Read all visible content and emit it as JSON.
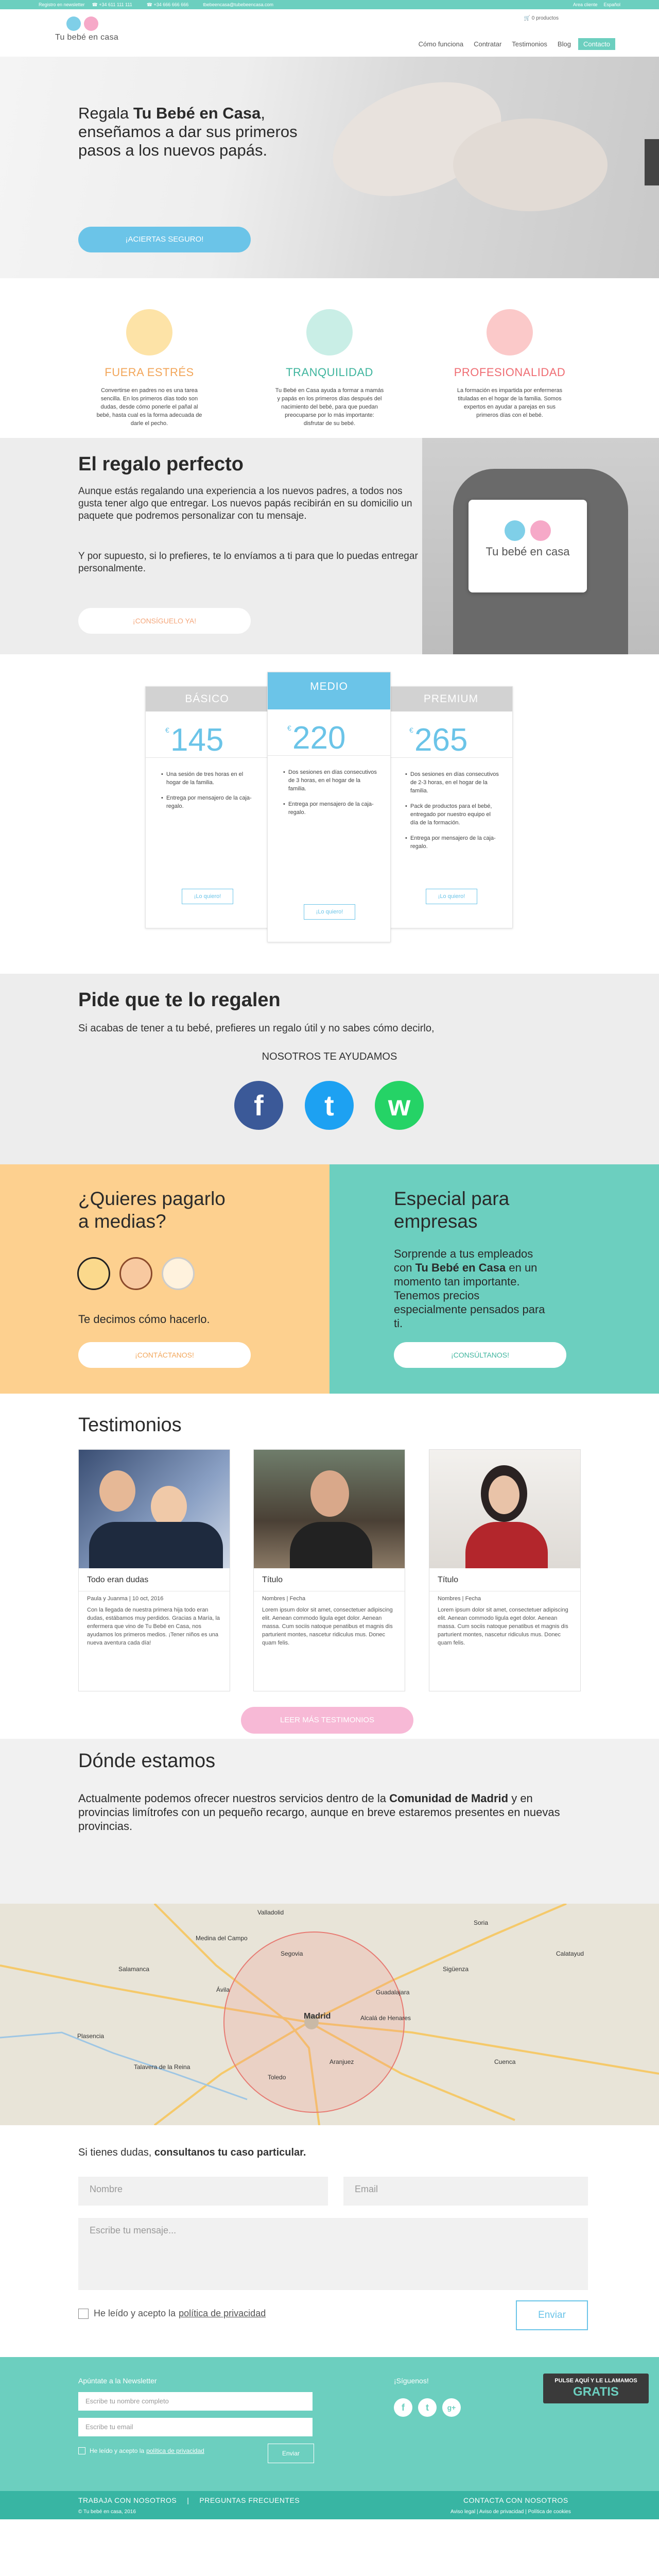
{
  "topbar": {
    "phone1": "+34 611 111 111",
    "phone2": "+34 666 666 666",
    "email": "tbebeencasa@tubebeencasa.com",
    "signup": "Registro en newsletter",
    "login": "Area cliente",
    "lang": "Español"
  },
  "header": {
    "logo_text": "Tu bebé en casa",
    "cart": "0 productos",
    "nav": [
      "Cómo funciona",
      "Contratar",
      "Testimonios",
      "Blog"
    ],
    "contact": "Contacto"
  },
  "hero": {
    "line1_pre": "Regala ",
    "line1_bold": "Tu Bebé en Casa",
    "line1_post": ",",
    "line2": "enseñamos a dar sus primeros",
    "line3": "pasos a los nuevos papás.",
    "cta": "¡ACIERTAS SEGURO!"
  },
  "features": [
    {
      "title": "FUERA ESTRÉS",
      "color": "#f2a65a",
      "text": "Convertirse en padres no es una tarea sencilla. En los primeros días todo son dudas, desde cómo ponerle el pañal al bebé, hasta cual es la forma adecuada de darle el pecho."
    },
    {
      "title": "TRANQUILIDAD",
      "color": "#3fb59e",
      "text": "Tu Bebé en Casa ayuda a formar a mamás y papás en los primeros días después del nacimiento del bebé, para que puedan preocuparse por lo más importante: disfrutar de su bebé."
    },
    {
      "title": "PROFESIONALIDAD",
      "color": "#ef6d73",
      "text": "La formación es impartida por enfermeras tituladas en el hogar de la familia. Somos expertos en ayudar a parejas en sus primeros días con el bebé."
    }
  ],
  "gift": {
    "title": "El regalo perfecto",
    "p1": "Aunque estás regalando una experiencia a los nuevos padres, a todos nos gusta tener algo que entregar. Los nuevos papás recibirán en su domicilio un paquete que podremos personalizar con tu mensaje.",
    "p2": "Y por supuesto, si lo prefieres, te lo envíamos a ti para que lo puedas entregar personalmente.",
    "cta": "¡CONSÍGUELO YA!",
    "sign_text": "Tu bebé en casa"
  },
  "pricing": {
    "currency": "€",
    "want": "¡Lo quiero!",
    "plans": [
      {
        "name": "BÁSICO",
        "price": "145",
        "items": [
          "Una sesión de tres horas en el hogar de la familia.",
          "Entrega por mensajero de la caja-regalo."
        ]
      },
      {
        "name": "MEDIO",
        "price": "220",
        "items": [
          "Dos sesiones en días consecutivos de 3 horas, en el hogar de la familia.",
          "Entrega por mensajero de la caja-regalo."
        ]
      },
      {
        "name": "PREMIUM",
        "price": "265",
        "items": [
          "Dos sesiones en días consecutivos de 2-3 horas, en el hogar de la familia.",
          "Pack de productos para el bebé, entregado por nuestro equipo el día de la formación.",
          "Entrega por mensajero de la caja-regalo."
        ]
      }
    ]
  },
  "ask": {
    "title": "Pide que te lo regalen",
    "text": "Si acabas de tener a tu bebé, prefieres un regalo útil y no sabes cómo decirlo,",
    "help": "NOSOTROS TE AYUDAMOS",
    "social_glyphs": [
      "f",
      "t",
      "w"
    ]
  },
  "split": {
    "left": {
      "title_l1": "¿Quieres pagarlo",
      "title_l2": "a medias?",
      "text": "Te decimos cómo hacerlo.",
      "cta": "¡CONTÁCTANOS!",
      "bg": "#fdd08f"
    },
    "right": {
      "title_l1": "Especial para",
      "title_l2": "empresas",
      "text_pre": "Sorprende a tus empleados con ",
      "text_bold": "Tu Bebé en Casa",
      "text_post": " en un momento tan importante. Tenemos precios especialmente pensados para ti.",
      "cta": "¡CONSÚLTANOS!",
      "bg": "#6ccfbf"
    }
  },
  "testimonials": {
    "title": "Testimonios",
    "more": "LEER MÁS TESTIMONIOS",
    "cards": [
      {
        "title": "Todo eran dudas",
        "meta": "Paula y Juanma | 10 oct, 2016",
        "body": "Con la llegada de nuestra primera hija todo eran dudas, estábamos muy perdidos. Gracias a María, la enfermera que vino de Tu Bebé en Casa, nos ayudamos los primeros medios. ¡Tener niños es una nueva aventura cada día!"
      },
      {
        "title": "Título",
        "meta": "Nombres | Fecha",
        "body": "Lorem ipsum dolor sit amet, consectetuer adipiscing elit. Aenean commodo ligula eget dolor. Aenean massa. Cum sociis natoque penatibus et magnis dis parturient montes, nascetur ridiculus mus. Donec quam felis."
      },
      {
        "title": "Título",
        "meta": "Nombres | Fecha",
        "body": "Lorem ipsum dolor sit amet, consectetuer adipiscing elit. Aenean commodo ligula eget dolor. Aenean massa. Cum sociis natoque penatibus et magnis dis parturient montes, nascetur ridiculus mus. Donec quam felis."
      }
    ]
  },
  "where": {
    "title": "Dónde estamos",
    "text_pre": "Actualmente podemos ofrecer nuestros servicios dentro de la ",
    "text_bold": "Comunidad de Madrid",
    "text_post": " y en provincias limítrofes con un pequeño recargo, aunque en breve estaremos presentes en nuevas provincias."
  },
  "map": {
    "labels": [
      "Madrid",
      "Segovia",
      "Ávila",
      "Toledo",
      "Guadalajara",
      "Cuenca",
      "Talavera de la Reina",
      "Aranjuez",
      "Valladolid",
      "Soria",
      "Salamanca",
      "Plasencia",
      "Alcalá de Henares",
      "Sigüenza",
      "Calatayud",
      "Medina del Campo"
    ]
  },
  "form": {
    "lead_pre": "Si tienes dudas, ",
    "lead_bold": "consultanos tu caso particular.",
    "name": "Nombre",
    "email": "Email",
    "message": "Escribe tu mensaje...",
    "accept": "He leído y acepto la",
    "policy": "política de privacidad",
    "send": "Enviar"
  },
  "footer": {
    "news_title": "Apúntate a la Newsletter",
    "news_name": "Escribe tu nombre completo",
    "news_email": "Escribe tu email",
    "news_accept": "He leído y acepto la",
    "news_policy": "política de privacidad",
    "news_send": "Enviar",
    "follow": "¡Síguenos!",
    "social": [
      "f",
      "t",
      "g+"
    ],
    "call_top": "PULSE AQUÍ Y LE LLAMAMOS",
    "call_bottom": "GRATIS",
    "links_left": [
      "TRABAJA CON NOSOTROS",
      "PREGUNTAS FRECUENTES"
    ],
    "copyright": "© Tu bebé en casa, 2016",
    "links_right": "CONTACTA CON NOSOTROS",
    "legal": "Aviso legal  |  Aviso de privacidad  |  Política de cookies"
  }
}
